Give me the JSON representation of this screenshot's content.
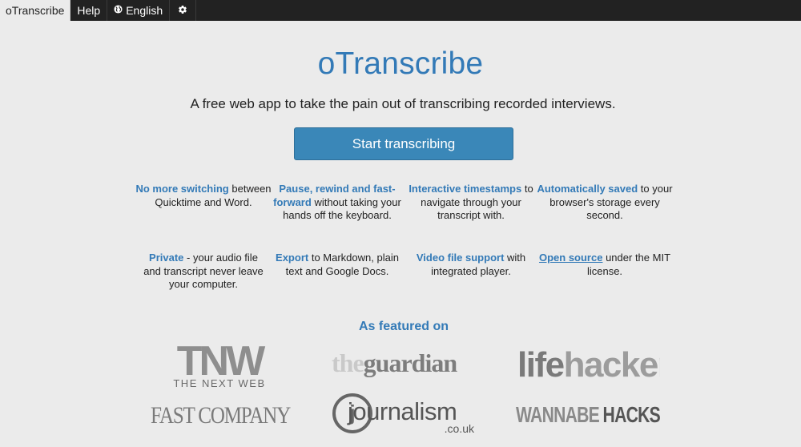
{
  "nav": {
    "brand": "oTranscribe",
    "help": "Help",
    "language": "English",
    "settings_icon": "gear-icon",
    "language_icon": "globe-icon"
  },
  "hero": {
    "title": "oTranscribe",
    "tagline": "A free web app to take the pain out of transcribing recorded interviews.",
    "start_button": "Start transcribing"
  },
  "features": [
    {
      "highlight": "No more switching",
      "rest": "between Quicktime and Word."
    },
    {
      "highlight": "Pause, rewind and fast-forward",
      "rest": "without taking your hands off the keyboard."
    },
    {
      "highlight": "Interactive timestamps",
      "rest": "to navigate through your transcript with."
    },
    {
      "highlight": "Automatically saved",
      "rest": "to your browser's storage every second."
    },
    {
      "highlight": "Private",
      "rest": "- your audio file and transcript never leave your computer."
    },
    {
      "highlight": "Export",
      "rest": "to Markdown, plain text and Google Docs."
    },
    {
      "highlight": "Video file support",
      "rest": "with integrated player."
    },
    {
      "highlight": "Open source",
      "rest": "under the MIT license."
    }
  ],
  "featured": {
    "heading": "As featured on",
    "logos": {
      "tnw": {
        "mark": "TNW",
        "sub": "THE NEXT WEB"
      },
      "guardian": {
        "light": "the",
        "bold": "guardian"
      },
      "lifehacker": {
        "part1": "life",
        "part2": "hacker"
      },
      "fastcompany": {
        "text": "FAST COMPANY"
      },
      "journalism": {
        "text": "journalism",
        "sub": ".co.uk"
      },
      "wannabe": {
        "part1": "WANNABE",
        "part2": "HACKS"
      }
    }
  },
  "colors": {
    "accent": "#337ab7",
    "button": "#3a87b8",
    "nav_bg": "#222222",
    "page_bg": "#ebebeb"
  }
}
